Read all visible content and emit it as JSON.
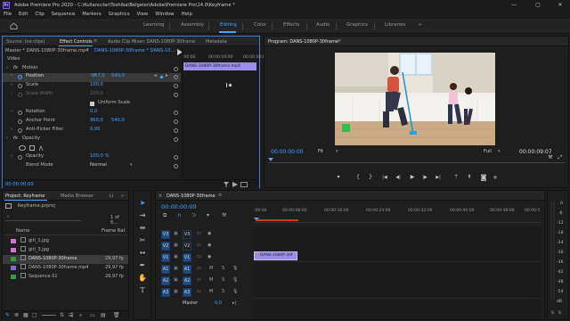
{
  "app": {
    "title": "Adobe Premiere Pro 2020 - C:\\Kullanıcılar\\Toshiba\\Belgeler\\Adobe\\Premiere Pro\\14.0\\Keyframe *",
    "logo_text": "Pr",
    "window_controls": [
      "—",
      "▢",
      "✕"
    ]
  },
  "menu": [
    "File",
    "Edit",
    "Clip",
    "Sequence",
    "Markers",
    "Graphics",
    "View",
    "Window",
    "Help"
  ],
  "workspaces": {
    "home_icon": "home-icon",
    "tabs": [
      "Learning",
      "Assembly",
      "Editing",
      "Color",
      "Effects",
      "Audio",
      "Graphics",
      "Libraries"
    ],
    "active": "Editing",
    "overflow": "»"
  },
  "effect_controls": {
    "tabs": [
      "Source: (no clips)",
      "Effect Controls",
      "Audio Clip Mixer: DANS-1080P-30frame",
      "Metadata"
    ],
    "menu_icon": "≡",
    "master_clip": "Master * DANS-1080P-30frame.mp4",
    "sequence_clip": "DANS-1080P-30frame * DANS-10...",
    "ruler_times": [
      ":00:00",
      "00:00:04:00",
      "00:00:08:0"
    ],
    "clip_bar_label": "DANS-1080P-30frame.mp4",
    "section_video": "Video",
    "motion": {
      "label": "Motion",
      "fx": "fx",
      "position_label": "Position",
      "position_x": "-967,0",
      "position_y": "540,0",
      "scale_label": "Scale",
      "scale_value": "100,0",
      "scale_width_label": "Scale Width",
      "scale_width_value": "100,0",
      "uniform_scale_label": "Uniform Scale",
      "rotation_label": "Rotation",
      "rotation_value": "0,0",
      "anchor_label": "Anchor Point",
      "anchor_x": "960,0",
      "anchor_y": "540,0",
      "antiflicker_label": "Anti-flicker Filter",
      "antiflicker_value": "0,00"
    },
    "opacity": {
      "label": "Opacity",
      "opacity_label": "Opacity",
      "opacity_value": "100,0 %",
      "blend_label": "Blend Mode",
      "blend_value": "Normal"
    },
    "timecode": "00:00:00:00"
  },
  "program": {
    "tab": "Program: DANS-1080P-30frame",
    "menu_icon": "≡",
    "timecode": "00:00:00:00",
    "fit": "Fit",
    "quality": "Full",
    "duration": "00:00:09:07",
    "transport_icons": [
      "marker-icon",
      "in-point-icon",
      "out-point-icon",
      "go-to-in-icon",
      "step-back-icon",
      "play-icon",
      "step-forward-icon",
      "go-to-out-icon",
      "lift-icon",
      "extract-icon",
      "export-frame-icon",
      "add-icon"
    ],
    "wrench": "wrench-icon",
    "fullscreen": "fullscreen-icon"
  },
  "project": {
    "tabs": [
      "Project: Keyframe",
      "Media Browser",
      "Li"
    ],
    "overflow": "»",
    "project_file": "Keyframe.prproj",
    "item_count": "1 of 5...",
    "col_name": "Name",
    "col_rate": "Frame Rat",
    "items": [
      {
        "name": "giti_1.jpg",
        "color": "#d86fd8",
        "rate": ""
      },
      {
        "name": "giti_3.jpg",
        "color": "#d86fd8",
        "rate": ""
      },
      {
        "name": "DANS-1080P-30frame",
        "color": "#2e9f3c",
        "rate": "29,97 fp"
      },
      {
        "name": "DANS-1080P-30frame.mp4",
        "color": "#7f6ad8",
        "rate": "29,97 fp"
      },
      {
        "name": "Sequence 01",
        "color": "#2e9f3c",
        "rate": "29,97 fp"
      }
    ],
    "footer_icons": [
      "pencil-icon",
      "list-view-icon",
      "icon-view-icon",
      "freeform-view-icon",
      "zoom-slider-icon",
      "sort-icon",
      "automate-icon",
      "search-icon",
      "new-bin-icon",
      "new-item-icon",
      "trash-icon"
    ]
  },
  "timeline": {
    "tab": "DANS-1080P-30frame",
    "menu_icon": "≡",
    "close_icon": "×",
    "timecode": "00:00:00:00",
    "ruler_times": [
      ":00:00",
      "00:00:08:00",
      "00:00:16:00",
      "00:00:24:00",
      "00:00:32:00",
      "00:00:40:00",
      "00:00:48:00",
      "00:00:5"
    ],
    "video_tracks": [
      {
        "src": "V3",
        "name": "V3"
      },
      {
        "src": "V2",
        "name": "V2"
      },
      {
        "src": "V1",
        "name": "V1"
      }
    ],
    "audio_tracks": [
      {
        "src": "A1",
        "name": "A1",
        "m": "M",
        "s": "S"
      },
      {
        "src": "A2",
        "name": "A2",
        "m": "M",
        "s": "S"
      },
      {
        "src": "A3",
        "name": "A3",
        "m": "M",
        "s": "S"
      }
    ],
    "master_label": "Master",
    "master_value": "0,0",
    "clip_label": "DANS-1080P-30f",
    "fx_badge": "fx"
  },
  "audio_meter": {
    "levels": [
      "0",
      "-6",
      "-12",
      "-18",
      "-24",
      "-30",
      "-36",
      "-42",
      "-48",
      "-54",
      "dB"
    ],
    "solo": [
      "S",
      "S"
    ]
  },
  "colors": {
    "accent": "#4aa3ff",
    "track_blue": "#1f4c86",
    "clip_purple": "#9b8ee6",
    "in_out_red": "#d0372f"
  }
}
